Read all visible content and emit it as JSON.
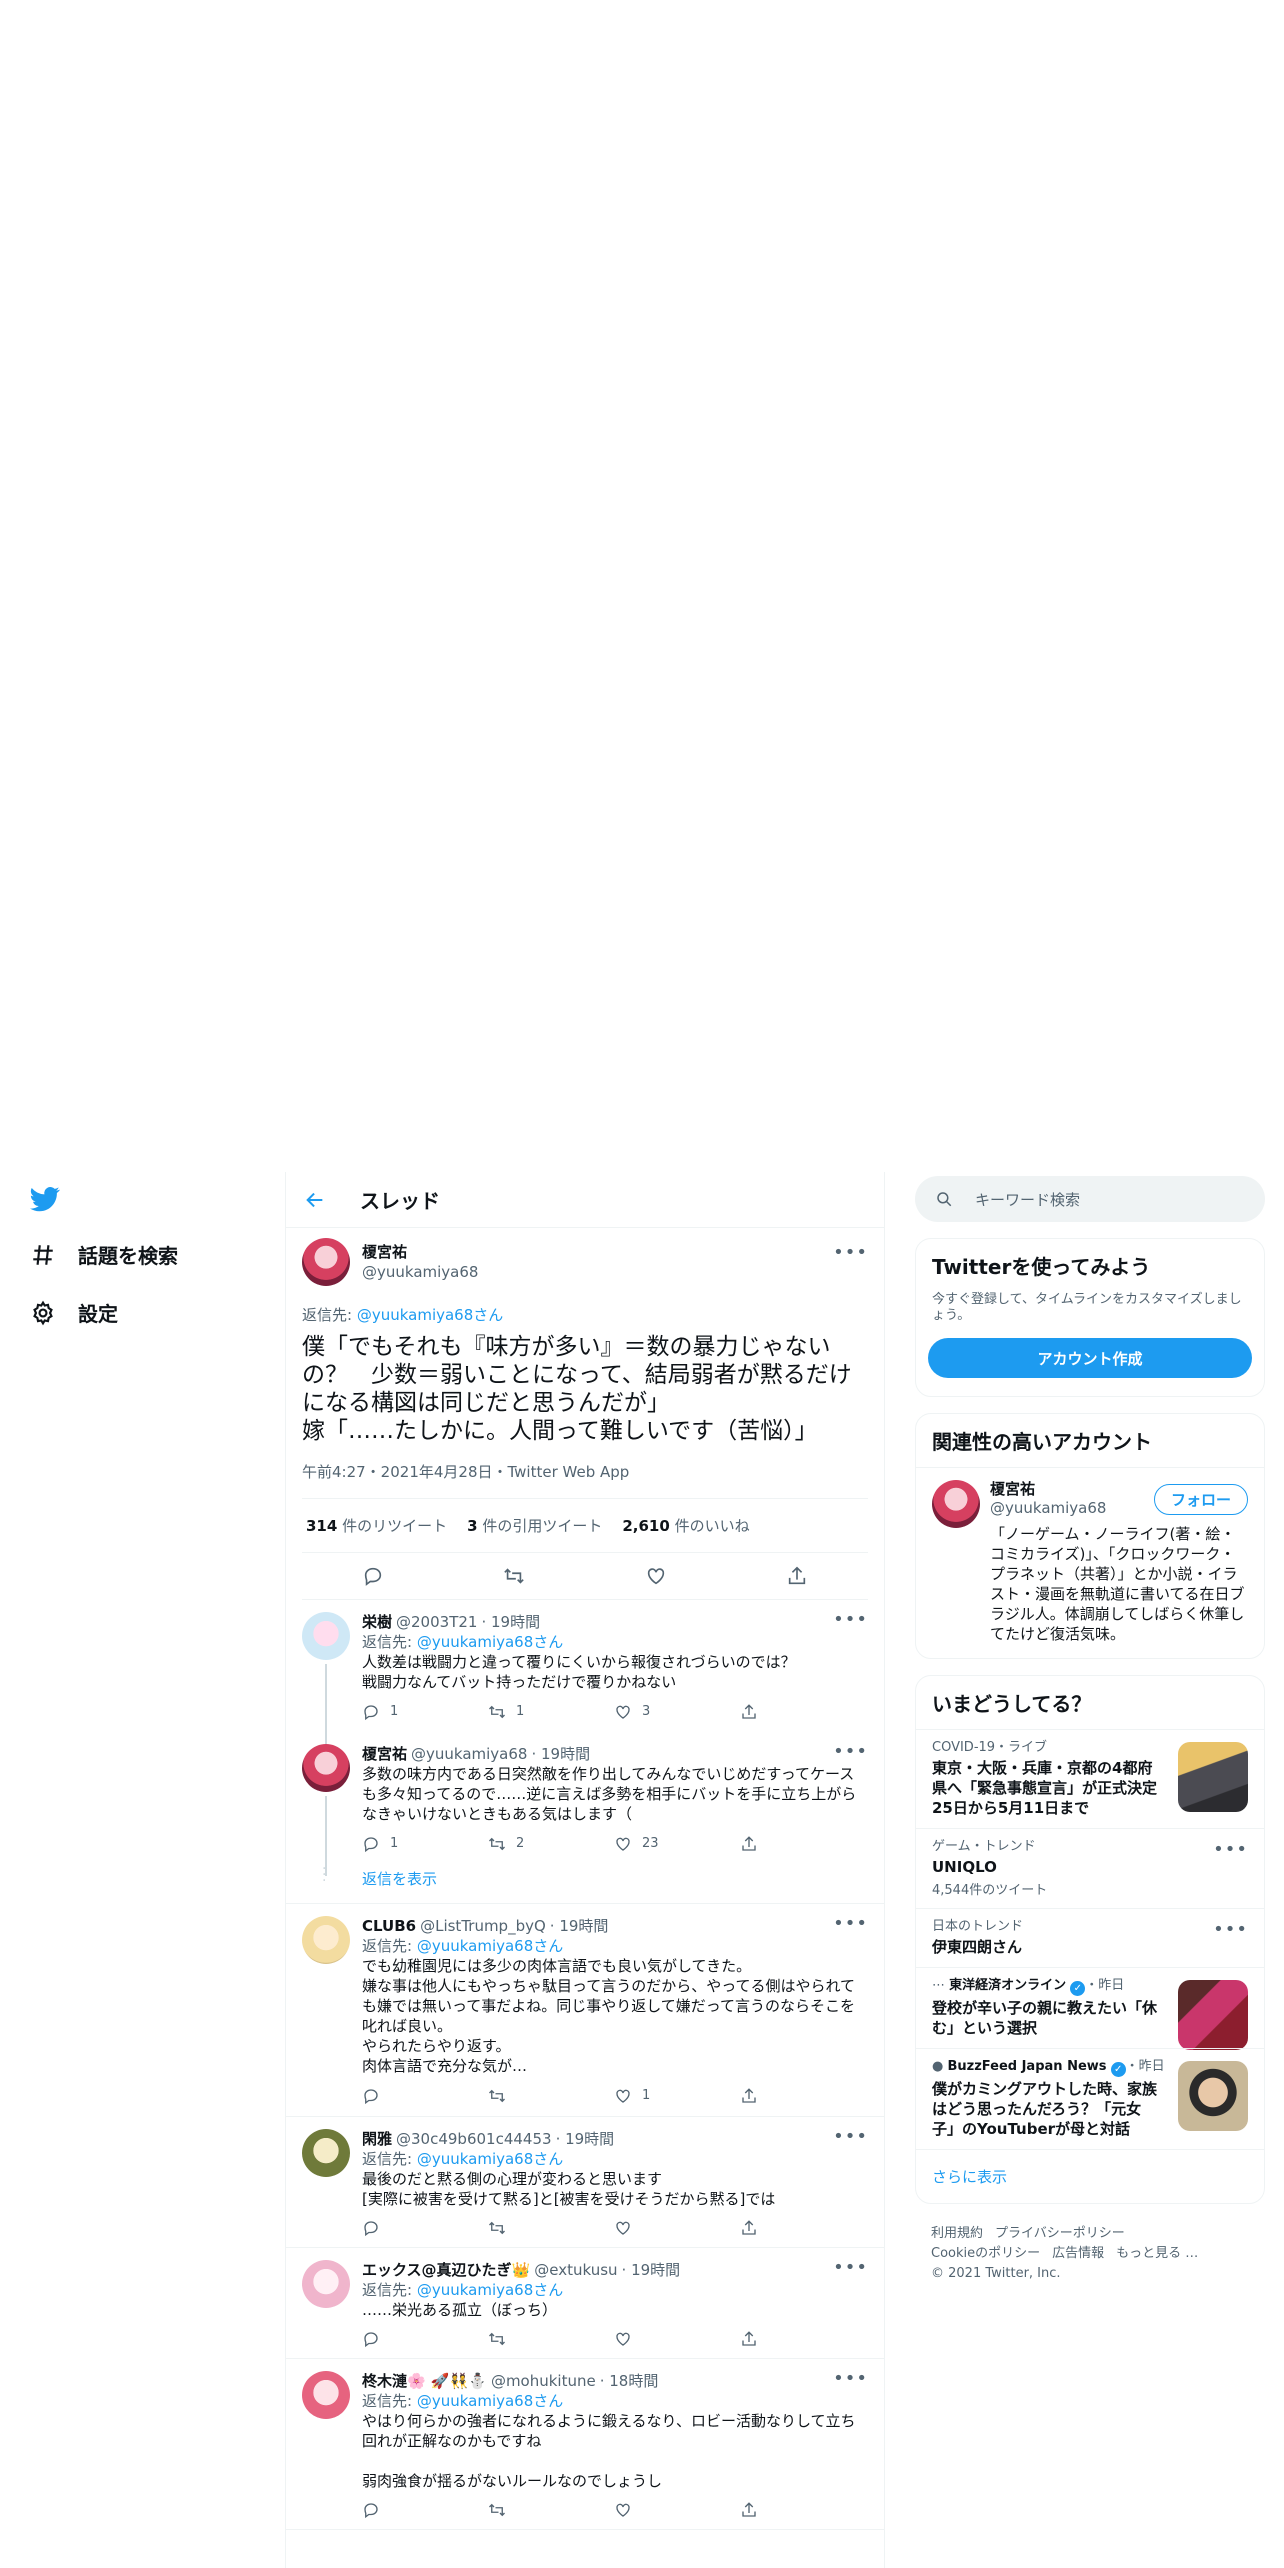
{
  "nav": {
    "explore_label": "話題を検索",
    "settings_label": "設定"
  },
  "header": {
    "title": "スレッド"
  },
  "focal": {
    "name": "榎宮祐",
    "handle": "@yuukamiya68",
    "reply_prefix": "返信先: ",
    "reply_handle": "@yuukamiya68",
    "reply_suffix": "さん",
    "text": "僕「でもそれも『味方が多い』＝数の暴力じゃないの？　少数＝弱いことになって、結局弱者が黙るだけになる構図は同じだと思うんだが」\n嫁「……たしかに。人間って難しいです（苦悩）」",
    "meta": "午前4:27・2021年4月28日・Twitter Web App",
    "retweets_num": "314",
    "retweets_label": "件のリツイート",
    "quotes_num": "3",
    "quotes_label": "件の引用ツイート",
    "likes_num": "2,610",
    "likes_label": "件のいいね"
  },
  "replies": [
    {
      "name": "栄樹",
      "handle": "@2003T21",
      "time": "· 19時間",
      "reply_handle": "@yuukamiya68",
      "text": "人数差は戦闘力と違って覆りにくいから報復されづらいのでは？\n戦闘力なんてバット持っただけで覆りかねない",
      "reply_count": "1",
      "retweet_count": "1",
      "like_count": "3"
    },
    {
      "name": "榎宮祐",
      "handle": "@yuukamiya68",
      "time": "· 19時間",
      "reply_handle": "@yuukamiya68",
      "text": "多数の味方内である日突然敵を作り出してみんなでいじめだすってケースも多々知ってるので……逆に言えば多勢を相手にバットを手に立ち上がらなきゃいけないときもある気はします（",
      "reply_count": "1",
      "retweet_count": "2",
      "like_count": "23"
    },
    {
      "name": "CLUB6",
      "handle": "@ListTrump_byQ",
      "time": "· 19時間",
      "reply_handle": "@yuukamiya68",
      "text": "でも幼稚園児には多少の肉体言語でも良い気がしてきた。\n嫌な事は他人にもやっちゃ駄目って言うのだから、やってる側はやられても嫌では無いって事だよね。同じ事やり返して嫌だって言うのならそこを叱れば良い。\nやられたらやり返す。\n肉体言語で充分な気が…",
      "reply_count": "",
      "retweet_count": "",
      "like_count": "1"
    },
    {
      "name": "閑雅",
      "handle": "@30c49b601c44453",
      "time": "· 19時間",
      "reply_handle": "@yuukamiya68",
      "text": "最後のだと黙る側の心理が変わると思います\n[実際に被害を受けて黙る]と[被害を受けそうだから黙る]では",
      "reply_count": "",
      "retweet_count": "",
      "like_count": ""
    },
    {
      "name": "エックス@真辺ひたぎ👑",
      "handle": "@extukusu",
      "time": "· 19時間",
      "reply_handle": "@yuukamiya68",
      "text": "……栄光ある孤立（ぼっち）",
      "reply_count": "",
      "retweet_count": "",
      "like_count": ""
    },
    {
      "name": "柊木漣🌸 🚀👯⛄",
      "handle": "@mohukitune",
      "time": "· 18時間",
      "reply_handle": "@yuukamiya68",
      "text": "やはり何らかの強者になれるように鍛えるなり、ロビー活動なりして立ち回れが正解なのかもですね\n\n弱肉強食が揺るがないルールなのでしょうし",
      "reply_count": "",
      "retweet_count": "",
      "like_count": ""
    }
  ],
  "show_replies_label": "返信を表示",
  "reply_prefix": "返信先: ",
  "reply_suffix": "さん",
  "right": {
    "search_placeholder": "キーワード検索",
    "try": {
      "title": "Twitterを使ってみよう",
      "subtitle": "今すぐ登録して、タイムラインをカスタマイズしましょう。",
      "signup_label": "アカウント作成"
    },
    "relevant": {
      "title": "関連性の高いアカウント",
      "name": "榎宮祐",
      "handle": "@yuukamiya68",
      "follow_label": "フォロー",
      "bio": "「ノーゲーム・ノーライフ(著・絵・コミカライズ)」、「クロックワーク・プラネット（共著）」とか小説・イラスト・漫画を無軌道に書いてる在日ブラジル人。体調崩してしばらく休筆してたけど復活気味。"
    },
    "trends_title": "いまどうしてる？",
    "trends": [
      {
        "meta": "COVID-19・ライブ",
        "title": "東京・大阪・兵庫・京都の4都府県へ「緊急事態宣言」が正式決定 25日から5月11日まで",
        "count": ""
      },
      {
        "meta": "ゲーム・トレンド",
        "title": "UNIQLO",
        "count": "4,544件のツイート"
      },
      {
        "meta": "日本のトレンド",
        "title": "伊東四朗さん",
        "count": ""
      },
      {
        "meta": "東洋経済オンライン",
        "meta_time": "・昨日",
        "title": "登校が辛い子の親に教えたい「休む」という選択",
        "count": ""
      },
      {
        "meta": "BuzzFeed Japan News",
        "meta_time": "・昨日",
        "title": "僕がカミングアウトした時、家族はどう思ったんだろう？「元女子」のYouTuberが母と対話",
        "count": ""
      }
    ],
    "show_more_label": "さらに表示",
    "footer": {
      "terms": "利用規約",
      "privacy": "プライバシーポリシー",
      "cookie": "Cookieのポリシー",
      "ads": "広告情報",
      "more": "もっと見る …",
      "copyright": "© 2021 Twitter, Inc."
    }
  }
}
